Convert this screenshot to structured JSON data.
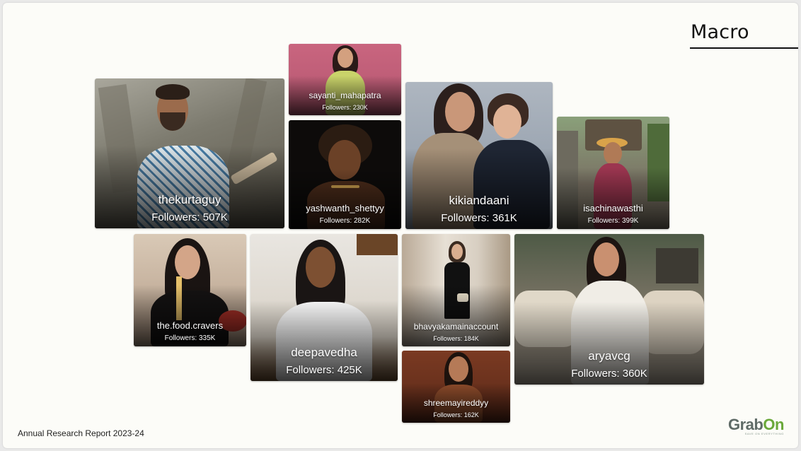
{
  "page": {
    "title": "Macro",
    "footer": "Annual Research Report 2023-24",
    "logo": {
      "text_main": "Grab",
      "text_accent": "On",
      "tagline": "SAVE ON EVERYTHING"
    },
    "followers_prefix": "Followers:"
  },
  "influencers": [
    {
      "id": "thekurtaguy",
      "handle": "thekurtaguy",
      "followers": "Followers: 507K"
    },
    {
      "id": "sayanti",
      "handle": "sayanti_mahapatra",
      "followers": "Followers: 230K"
    },
    {
      "id": "yashwanth",
      "handle": "yashwanth_shettyy",
      "followers": "Followers: 282K"
    },
    {
      "id": "kikiandaani",
      "handle": "kikiandaani",
      "followers": "Followers: 361K"
    },
    {
      "id": "isachinawasthi",
      "handle": "isachinawasthi",
      "followers": "Followers: 399K"
    },
    {
      "id": "foodcravers",
      "handle": "the.food.cravers",
      "followers": "Followers: 335K"
    },
    {
      "id": "deepavedha",
      "handle": "deepavedha",
      "followers": "Followers: 425K"
    },
    {
      "id": "bhavyakama",
      "handle": "bhavyakamainaccount",
      "followers": "Followers: 184K"
    },
    {
      "id": "shreemayi",
      "handle": "shreemayireddyy",
      "followers": "Followers: 162K"
    },
    {
      "id": "aryavcg",
      "handle": "aryavcg",
      "followers": "Followers: 360K"
    }
  ]
}
